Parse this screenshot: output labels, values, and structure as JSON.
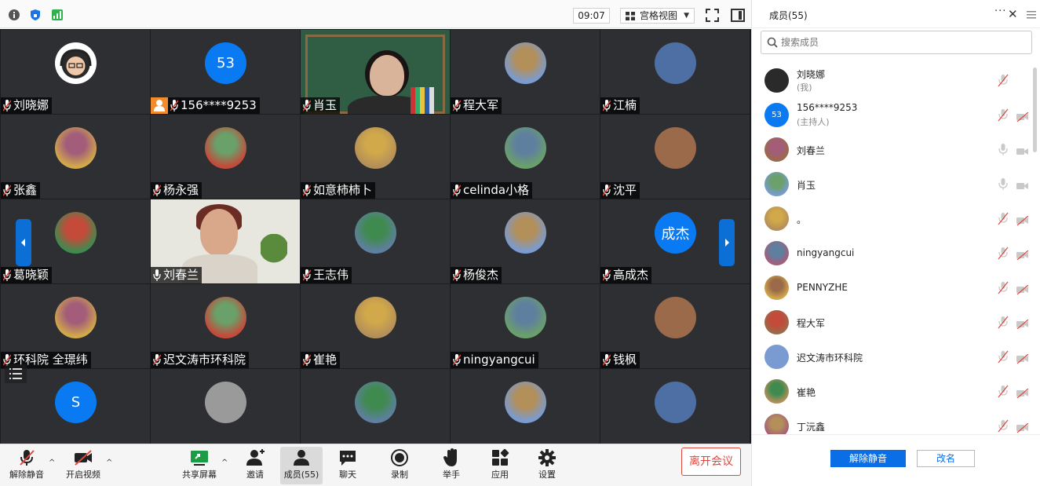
{
  "clock": "09:07",
  "view_mode": "宫格视图",
  "tiles": [
    {
      "name": "刘晓娜",
      "avatar": "cartoon"
    },
    {
      "name": "156****9253",
      "avatar": "53",
      "host": true
    },
    {
      "name": "肖玉",
      "avatar": "teacher-video"
    },
    {
      "name": "程大军",
      "avatar": "photo"
    },
    {
      "name": "江楠",
      "avatar": "photo"
    },
    {
      "name": "张鑫",
      "avatar": "photo"
    },
    {
      "name": "杨永强",
      "avatar": "photo"
    },
    {
      "name": "如意柿柿卜",
      "avatar": "photo"
    },
    {
      "name": "celinda小格",
      "avatar": "photo"
    },
    {
      "name": "沈平",
      "avatar": "photo"
    },
    {
      "name": "葛晓颖",
      "avatar": "photo"
    },
    {
      "name": "刘春兰",
      "avatar": "lady-video",
      "active": true
    },
    {
      "name": "王志伟",
      "avatar": "photo"
    },
    {
      "name": "杨俊杰",
      "avatar": "photo"
    },
    {
      "name": "高成杰",
      "avatar": "成杰"
    },
    {
      "name": "环科院 全璟纬",
      "avatar": "photo"
    },
    {
      "name": "迟文涛市环科院",
      "avatar": "photo"
    },
    {
      "name": "崔艳",
      "avatar": "photo"
    },
    {
      "name": "ningyangcui",
      "avatar": "photo"
    },
    {
      "name": "钱枫",
      "avatar": "photo"
    },
    {
      "name": "",
      "avatar": "S"
    },
    {
      "name": "",
      "avatar": "grey"
    },
    {
      "name": "",
      "avatar": "photo"
    },
    {
      "name": "",
      "avatar": "photo"
    },
    {
      "name": "",
      "avatar": "photo"
    }
  ],
  "toolbar": {
    "unmute": "解除静音",
    "start_video": "开启视频",
    "share_screen": "共享屏幕",
    "invite": "邀请",
    "members": "成员(55)",
    "chat": "聊天",
    "record": "录制",
    "raise_hand": "举手",
    "apps": "应用",
    "settings": "设置",
    "leave": "离开会议"
  },
  "panel": {
    "title": "成员(55)",
    "search_placeholder": "搜索成员",
    "members": [
      {
        "name": "刘晓娜",
        "sub": "(我)",
        "avatar": "cartoon",
        "muted": true,
        "cam": false
      },
      {
        "name": "156****9253",
        "sub": "(主持人)",
        "avatar": "53",
        "muted": true,
        "cam": true
      },
      {
        "name": "刘春兰",
        "sub": "",
        "avatar": "photo",
        "muted": false,
        "cam": true
      },
      {
        "name": "肖玉",
        "sub": "",
        "avatar": "photo",
        "muted": false,
        "cam": true
      },
      {
        "name": "。",
        "sub": "",
        "avatar": "photo",
        "muted": true,
        "cam": true
      },
      {
        "name": "ningyangcui",
        "sub": "",
        "avatar": "photo",
        "muted": true,
        "cam": true
      },
      {
        "name": "PENNYZHE",
        "sub": "",
        "avatar": "photo",
        "muted": true,
        "cam": true
      },
      {
        "name": "程大军",
        "sub": "",
        "avatar": "photo",
        "muted": true,
        "cam": true
      },
      {
        "name": "迟文涛市环科院",
        "sub": "",
        "avatar": "photo",
        "muted": true,
        "cam": true
      },
      {
        "name": "崔艳",
        "sub": "",
        "avatar": "photo",
        "muted": true,
        "cam": true
      },
      {
        "name": "丁沅鑫",
        "sub": "",
        "avatar": "photo",
        "muted": true,
        "cam": true
      }
    ],
    "unmute_all": "解除静音",
    "rename": "改名"
  },
  "colors": {
    "accent": "#0a7af2",
    "leave": "#e0473e",
    "active_border": "#4aa83e",
    "host_badge": "#f08c2b"
  }
}
